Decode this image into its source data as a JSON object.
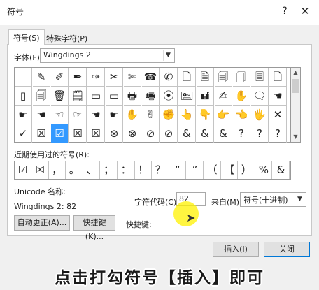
{
  "window": {
    "title": "符号",
    "help": "?",
    "close": "✕"
  },
  "tabs": [
    {
      "label": "符号(S)"
    },
    {
      "label": "特殊字符(P)"
    }
  ],
  "font": {
    "label": "字体(F):",
    "value": "Wingdings 2"
  },
  "symbol_grid": {
    "rows": [
      [
        " ",
        "✎",
        "✐",
        "✒",
        "✑",
        "✂",
        "✄",
        "☎",
        "✆",
        "🗋",
        "🗎",
        "🗐",
        "🗍",
        "🗏",
        "🗋"
      ],
      [
        "▯",
        "🗐",
        "🗑",
        "🗒",
        "▭",
        "▭",
        "🖶",
        "🖷",
        "⦿",
        "🖭",
        "🖬",
        "✍",
        "✋",
        "🗨",
        "☚"
      ],
      [
        "☛",
        "☚",
        "☜",
        "☞",
        "☚",
        "☛",
        "✋",
        "✌",
        "✊",
        "👆",
        "👇",
        "👉",
        "👈",
        "🖐",
        "✕"
      ],
      [
        "✓",
        "☒",
        "☑",
        "☒",
        "☒",
        "⊗",
        "⊗",
        "⊘",
        "⊘",
        "&",
        "&",
        "&",
        "?",
        "?",
        "?"
      ]
    ],
    "selected": {
      "row": 3,
      "col": 2
    }
  },
  "recent": {
    "label": "近期使用过的符号(R):",
    "symbols": [
      "☑",
      "☒",
      "，",
      "。",
      "、",
      "；",
      "：",
      "！",
      "？",
      "“",
      "”",
      "（",
      "【",
      "）",
      "%",
      "&"
    ]
  },
  "unicode_label": "Unicode 名称:",
  "wingdings_label": "Wingdings 2: 82",
  "char_code": {
    "label": "字符代码(C):",
    "value": "82"
  },
  "from": {
    "label": "来自(M):",
    "value": "符号(十进制)"
  },
  "buttons": {
    "autocorrect": "自动更正(A)...",
    "shortcut": "快捷键(K)...",
    "insert": "插入(I)",
    "close": "关闭"
  },
  "shortcut_label": "快捷键:",
  "caption": "点击打勾符号【插入】即可"
}
